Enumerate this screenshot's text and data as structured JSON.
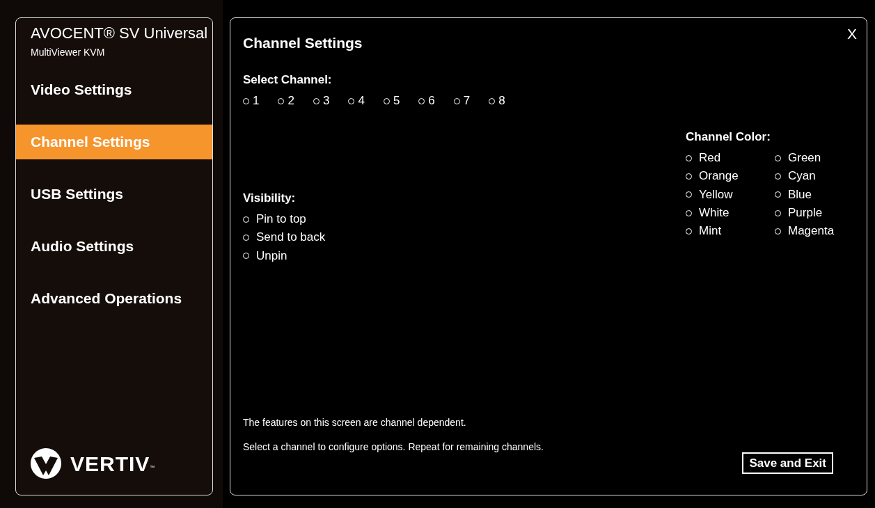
{
  "sidebar": {
    "title": "AVOCENT® SV Universal",
    "subtitle": "MultiViewer KVM",
    "items": [
      {
        "label": "Video Settings",
        "selected": false
      },
      {
        "label": "Channel Settings",
        "selected": true
      },
      {
        "label": "USB Settings",
        "selected": false
      },
      {
        "label": "Audio Settings",
        "selected": false
      },
      {
        "label": "Advanced Operations",
        "selected": false
      }
    ],
    "logo": {
      "text": "VERTIV",
      "trademark": "™"
    }
  },
  "panel": {
    "title": "Channel Settings",
    "close": "X",
    "select_channel": {
      "label": "Select Channel:",
      "options": [
        {
          "label": "1",
          "selected": false
        },
        {
          "label": "2",
          "selected": false
        },
        {
          "label": "3",
          "selected": false
        },
        {
          "label": "4",
          "selected": false
        },
        {
          "label": "5",
          "selected": false
        },
        {
          "label": "6",
          "selected": false
        },
        {
          "label": "7",
          "selected": false
        },
        {
          "label": "8",
          "selected": false
        }
      ]
    },
    "channel_color": {
      "label": "Channel Color:",
      "options": [
        {
          "label": "Red",
          "selected": false
        },
        {
          "label": "Orange",
          "selected": false
        },
        {
          "label": "Yellow",
          "selected": false
        },
        {
          "label": "White",
          "selected": false
        },
        {
          "label": "Mint",
          "selected": false
        },
        {
          "label": "Green",
          "selected": false
        },
        {
          "label": "Cyan",
          "selected": false
        },
        {
          "label": "Blue",
          "selected": false
        },
        {
          "label": "Purple",
          "selected": false
        },
        {
          "label": "Magenta",
          "selected": false
        }
      ]
    },
    "visibility": {
      "label": "Visibility:",
      "options": [
        {
          "label": "Pin to top",
          "selected": false
        },
        {
          "label": "Send to back",
          "selected": false
        },
        {
          "label": "Unpin",
          "selected": false
        }
      ]
    },
    "notes": [
      "The features on this screen are channel dependent.",
      "Select a channel to configure options. Repeat for remaining channels."
    ],
    "save_button": "Save and Exit"
  }
}
